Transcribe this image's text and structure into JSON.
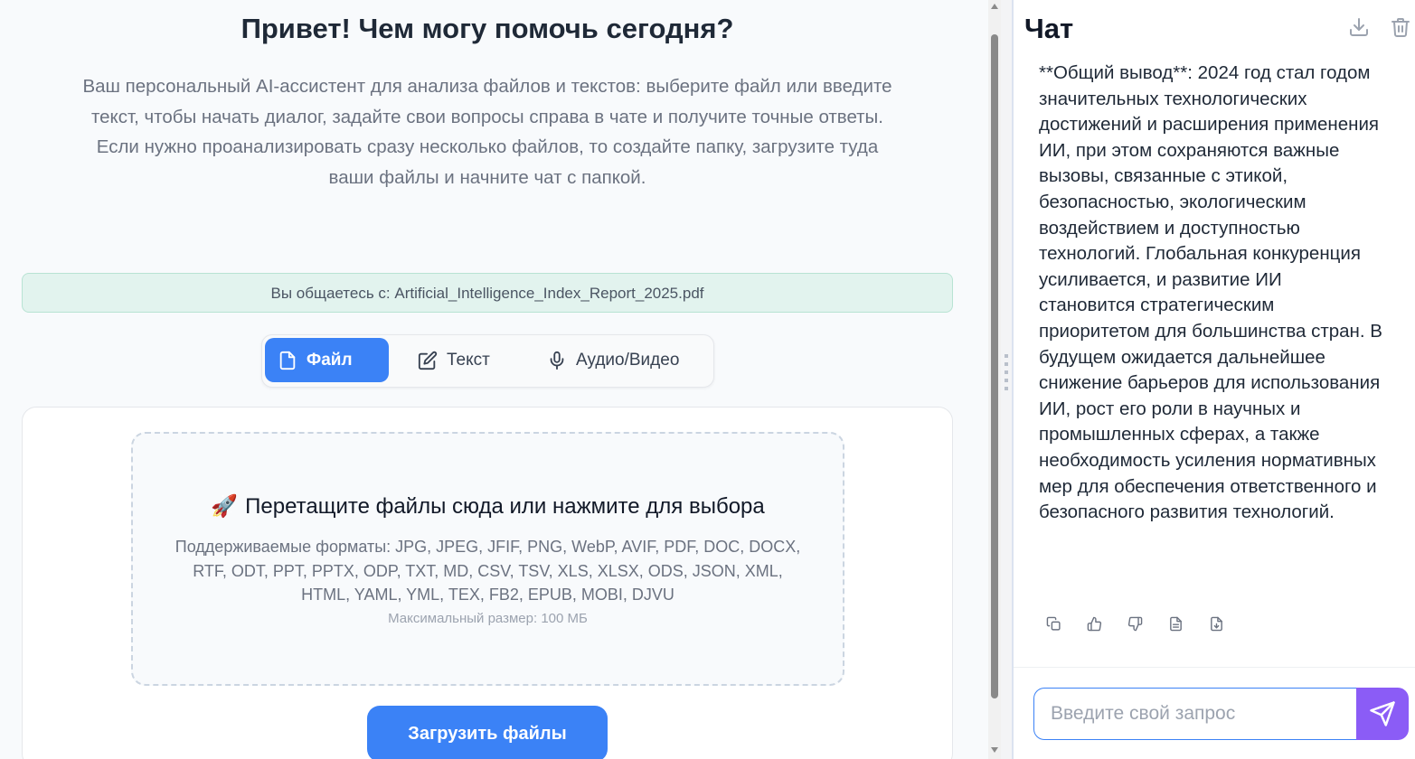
{
  "header": {
    "title": "Привет! Чем могу помочь сегодня?",
    "description": "Ваш персональный AI-ассистент для анализа файлов и текстов: выберите файл или введите текст, чтобы начать диалог, задайте свои вопросы справа в чате и получите точные ответы. Если нужно проанализировать сразу несколько файлов, то создайте папку, загрузите туда ваши файлы и начните чат с папкой."
  },
  "notice": {
    "text": "Вы общаетесь с: Artificial_Intelligence_Index_Report_2025.pdf"
  },
  "tabs": [
    {
      "label": "Файл",
      "icon": "file-icon",
      "active": true
    },
    {
      "label": "Текст",
      "icon": "edit-icon",
      "active": false
    },
    {
      "label": "Аудио/Видео",
      "icon": "microphone-icon",
      "active": false
    }
  ],
  "dropzone": {
    "emoji": "🚀",
    "title": "Перетащите файлы сюда или нажмите для выбора",
    "formats": "Поддерживаемые форматы: JPG, JPEG, JFIF, PNG, WebP, AVIF, PDF, DOC, DOCX, RTF, ODT, PPT, PPTX, ODP, TXT, MD, CSV, TSV, XLS, XLSX, ODS, JSON, XML, HTML, YAML, YML, TEX, FB2, EPUB, MOBI, DJVU",
    "max_size": "Максимальный размер: 100 МБ"
  },
  "upload_button": "Загрузить файлы",
  "chat": {
    "title": "Чат",
    "message": "**Общий вывод**: 2024 год стал годом значительных технологических достижений и расширения применения ИИ, при этом сохраняются важные вызовы, связанные с этикой, безопасностью, экологическим воздействием и доступностью технологий. Глобальная конкуренция усиливается, и развитие ИИ становится стратегическим приоритетом для большинства стран. В будущем ожидается дальнейшее снижение барьеров для использования ИИ, рост его роли в научных и промышленных сферах, а также необходимость усиления нормативных мер для обеспечения ответственного и безопасного развития технологий.",
    "input_placeholder": "Введите свой запрос"
  },
  "colors": {
    "accent": "#3b82f6",
    "send": "#8b5cf6",
    "notice_bg": "#e2f3ee"
  }
}
